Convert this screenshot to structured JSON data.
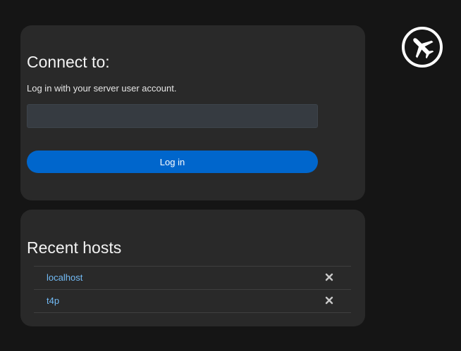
{
  "login": {
    "title": "Connect to:",
    "subtitle": "Log in with your server user account.",
    "input_value": "",
    "button_label": "Log in"
  },
  "recent_hosts": {
    "title": "Recent hosts",
    "items": [
      {
        "name": "localhost",
        "remove_icon": "close-icon"
      },
      {
        "name": "t4p",
        "remove_icon": "close-icon"
      }
    ]
  },
  "logo": {
    "icon": "airplane-icon"
  },
  "colors": {
    "background": "#151515",
    "card": "#292929",
    "accent": "#0066cc",
    "link": "#73bcf7"
  }
}
